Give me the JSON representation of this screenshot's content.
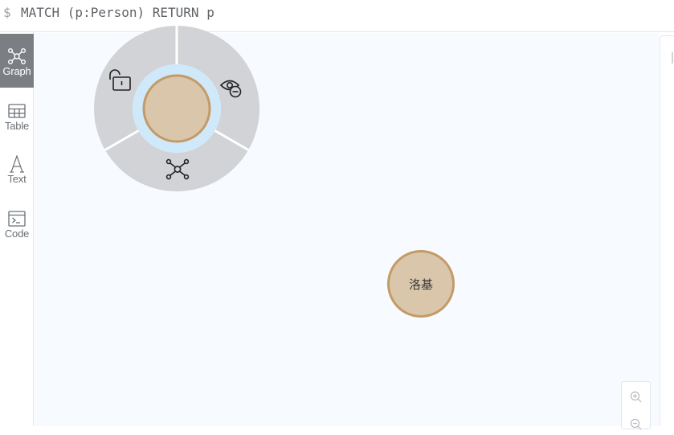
{
  "query": {
    "prompt": "$",
    "text": "MATCH (p:Person) RETURN p"
  },
  "sidebar": {
    "items": [
      {
        "label": "Graph",
        "icon": "graph-icon",
        "active": true
      },
      {
        "label": "Table",
        "icon": "table-icon",
        "active": false
      },
      {
        "label": "Text",
        "icon": "text-icon",
        "active": false
      },
      {
        "label": "Code",
        "icon": "code-icon",
        "active": false
      }
    ]
  },
  "graph": {
    "nodes": [
      {
        "label": "洛基",
        "color": "#dac7ab",
        "border": "#c49a67"
      },
      {
        "label": "",
        "color": "#dac7ab",
        "border": "#c49a67",
        "selected": true
      }
    ],
    "ring_menu": {
      "items": [
        {
          "action": "unlock",
          "icon": "unlock-icon"
        },
        {
          "action": "hide",
          "icon": "eye-hide-icon"
        },
        {
          "action": "expand",
          "icon": "expand-graph-icon"
        }
      ]
    }
  },
  "zoom": {
    "controls": [
      {
        "action": "zoom-in",
        "icon": "zoom-in-icon"
      },
      {
        "action": "zoom-out",
        "icon": "zoom-out-icon"
      }
    ]
  },
  "colors": {
    "node_fill": "#dac7ab",
    "node_border": "#c49a67",
    "ring_gray": "#d1d3d6",
    "ring_highlight": "#cfe9fb",
    "nav_active": "#7b7f84",
    "canvas_bg": "#f7fafe"
  }
}
